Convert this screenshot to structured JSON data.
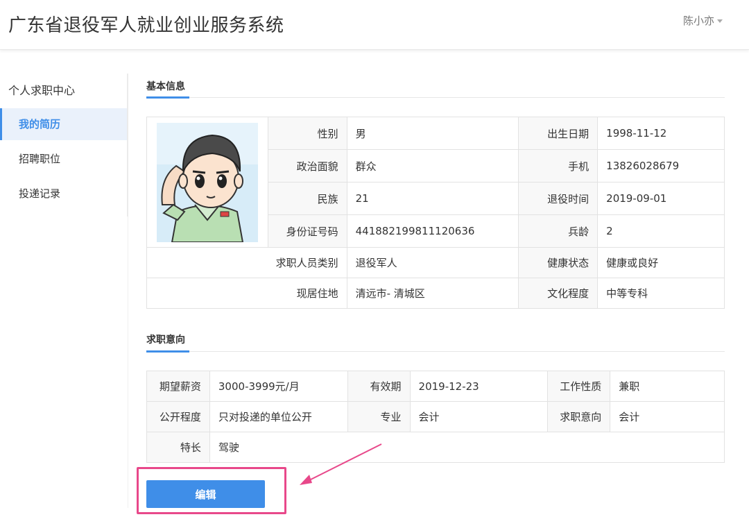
{
  "header": {
    "title": "广东省退役军人就业创业服务系统",
    "user": "陈小亦"
  },
  "sidebar": {
    "heading": "个人求职中心",
    "items": [
      {
        "label": "我的简历",
        "active": true
      },
      {
        "label": "招聘职位",
        "active": false
      },
      {
        "label": "投递记录",
        "active": false
      }
    ]
  },
  "basic_info": {
    "title": "基本信息",
    "rows": [
      {
        "l1": "性别",
        "v1": "男",
        "l2": "出生日期",
        "v2": "1998-11-12"
      },
      {
        "l1": "政治面貌",
        "v1": "群众",
        "l2": "手机",
        "v2": "13826028679"
      },
      {
        "l1": "民族",
        "v1": "21",
        "l2": "退役时间",
        "v2": "2019-09-01"
      },
      {
        "l1": "身份证号码",
        "v1": "441882199811120636",
        "l2": "兵龄",
        "v2": "2"
      },
      {
        "l1": "求职人员类别",
        "v1": "退役军人",
        "l2": "健康状态",
        "v2": "健康或良好"
      },
      {
        "l1": "现居住地",
        "v1": "清远市- 清城区",
        "l2": "文化程度",
        "v2": "中等专科"
      }
    ]
  },
  "job_intent": {
    "title": "求职意向",
    "rows": [
      {
        "l1": "期望薪资",
        "v1": "3000-3999元/月",
        "l2": "有效期",
        "v2": "2019-12-23",
        "l3": "工作性质",
        "v3": "兼职"
      },
      {
        "l1": "公开程度",
        "v1": "只对投递的单位公开",
        "l2": "专业",
        "v2": "会计",
        "l3": "求职意向",
        "v3": "会计"
      },
      {
        "l1": "特长",
        "v1": "驾驶"
      }
    ]
  },
  "actions": {
    "edit_label": "编辑"
  },
  "colors": {
    "accent": "#3f8ee8",
    "highlight": "#e8488a"
  }
}
